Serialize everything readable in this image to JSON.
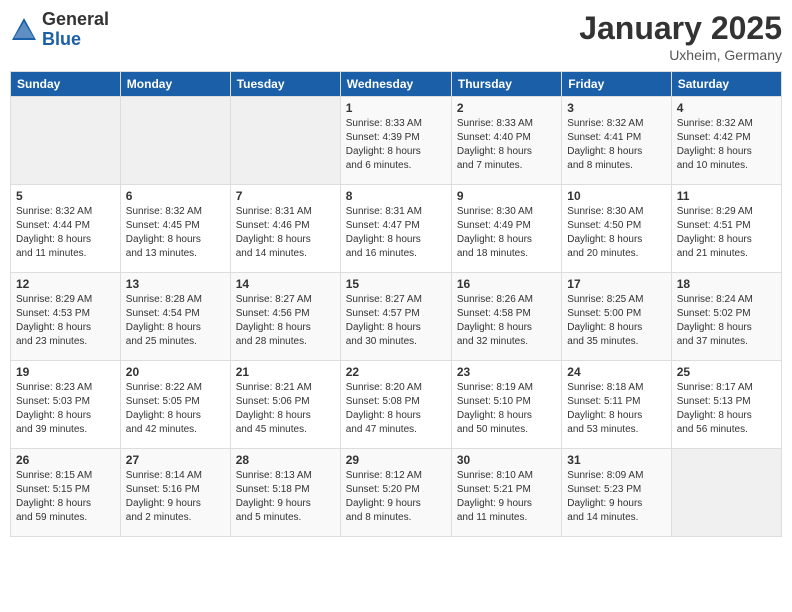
{
  "header": {
    "logo_general": "General",
    "logo_blue": "Blue",
    "month_title": "January 2025",
    "location": "Uxheim, Germany"
  },
  "days_of_week": [
    "Sunday",
    "Monday",
    "Tuesday",
    "Wednesday",
    "Thursday",
    "Friday",
    "Saturday"
  ],
  "weeks": [
    [
      {
        "day": "",
        "info": ""
      },
      {
        "day": "",
        "info": ""
      },
      {
        "day": "",
        "info": ""
      },
      {
        "day": "1",
        "info": "Sunrise: 8:33 AM\nSunset: 4:39 PM\nDaylight: 8 hours\nand 6 minutes."
      },
      {
        "day": "2",
        "info": "Sunrise: 8:33 AM\nSunset: 4:40 PM\nDaylight: 8 hours\nand 7 minutes."
      },
      {
        "day": "3",
        "info": "Sunrise: 8:32 AM\nSunset: 4:41 PM\nDaylight: 8 hours\nand 8 minutes."
      },
      {
        "day": "4",
        "info": "Sunrise: 8:32 AM\nSunset: 4:42 PM\nDaylight: 8 hours\nand 10 minutes."
      }
    ],
    [
      {
        "day": "5",
        "info": "Sunrise: 8:32 AM\nSunset: 4:44 PM\nDaylight: 8 hours\nand 11 minutes."
      },
      {
        "day": "6",
        "info": "Sunrise: 8:32 AM\nSunset: 4:45 PM\nDaylight: 8 hours\nand 13 minutes."
      },
      {
        "day": "7",
        "info": "Sunrise: 8:31 AM\nSunset: 4:46 PM\nDaylight: 8 hours\nand 14 minutes."
      },
      {
        "day": "8",
        "info": "Sunrise: 8:31 AM\nSunset: 4:47 PM\nDaylight: 8 hours\nand 16 minutes."
      },
      {
        "day": "9",
        "info": "Sunrise: 8:30 AM\nSunset: 4:49 PM\nDaylight: 8 hours\nand 18 minutes."
      },
      {
        "day": "10",
        "info": "Sunrise: 8:30 AM\nSunset: 4:50 PM\nDaylight: 8 hours\nand 20 minutes."
      },
      {
        "day": "11",
        "info": "Sunrise: 8:29 AM\nSunset: 4:51 PM\nDaylight: 8 hours\nand 21 minutes."
      }
    ],
    [
      {
        "day": "12",
        "info": "Sunrise: 8:29 AM\nSunset: 4:53 PM\nDaylight: 8 hours\nand 23 minutes."
      },
      {
        "day": "13",
        "info": "Sunrise: 8:28 AM\nSunset: 4:54 PM\nDaylight: 8 hours\nand 25 minutes."
      },
      {
        "day": "14",
        "info": "Sunrise: 8:27 AM\nSunset: 4:56 PM\nDaylight: 8 hours\nand 28 minutes."
      },
      {
        "day": "15",
        "info": "Sunrise: 8:27 AM\nSunset: 4:57 PM\nDaylight: 8 hours\nand 30 minutes."
      },
      {
        "day": "16",
        "info": "Sunrise: 8:26 AM\nSunset: 4:58 PM\nDaylight: 8 hours\nand 32 minutes."
      },
      {
        "day": "17",
        "info": "Sunrise: 8:25 AM\nSunset: 5:00 PM\nDaylight: 8 hours\nand 35 minutes."
      },
      {
        "day": "18",
        "info": "Sunrise: 8:24 AM\nSunset: 5:02 PM\nDaylight: 8 hours\nand 37 minutes."
      }
    ],
    [
      {
        "day": "19",
        "info": "Sunrise: 8:23 AM\nSunset: 5:03 PM\nDaylight: 8 hours\nand 39 minutes."
      },
      {
        "day": "20",
        "info": "Sunrise: 8:22 AM\nSunset: 5:05 PM\nDaylight: 8 hours\nand 42 minutes."
      },
      {
        "day": "21",
        "info": "Sunrise: 8:21 AM\nSunset: 5:06 PM\nDaylight: 8 hours\nand 45 minutes."
      },
      {
        "day": "22",
        "info": "Sunrise: 8:20 AM\nSunset: 5:08 PM\nDaylight: 8 hours\nand 47 minutes."
      },
      {
        "day": "23",
        "info": "Sunrise: 8:19 AM\nSunset: 5:10 PM\nDaylight: 8 hours\nand 50 minutes."
      },
      {
        "day": "24",
        "info": "Sunrise: 8:18 AM\nSunset: 5:11 PM\nDaylight: 8 hours\nand 53 minutes."
      },
      {
        "day": "25",
        "info": "Sunrise: 8:17 AM\nSunset: 5:13 PM\nDaylight: 8 hours\nand 56 minutes."
      }
    ],
    [
      {
        "day": "26",
        "info": "Sunrise: 8:15 AM\nSunset: 5:15 PM\nDaylight: 8 hours\nand 59 minutes."
      },
      {
        "day": "27",
        "info": "Sunrise: 8:14 AM\nSunset: 5:16 PM\nDaylight: 9 hours\nand 2 minutes."
      },
      {
        "day": "28",
        "info": "Sunrise: 8:13 AM\nSunset: 5:18 PM\nDaylight: 9 hours\nand 5 minutes."
      },
      {
        "day": "29",
        "info": "Sunrise: 8:12 AM\nSunset: 5:20 PM\nDaylight: 9 hours\nand 8 minutes."
      },
      {
        "day": "30",
        "info": "Sunrise: 8:10 AM\nSunset: 5:21 PM\nDaylight: 9 hours\nand 11 minutes."
      },
      {
        "day": "31",
        "info": "Sunrise: 8:09 AM\nSunset: 5:23 PM\nDaylight: 9 hours\nand 14 minutes."
      },
      {
        "day": "",
        "info": ""
      }
    ]
  ]
}
